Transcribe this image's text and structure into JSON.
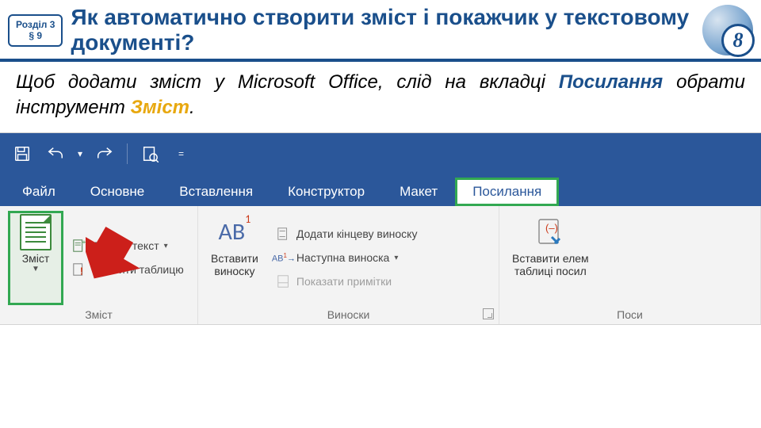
{
  "header": {
    "chapter": "Розділ 3",
    "section": "§ 9",
    "title": "Як автоматично створити зміст і покажчик у текстовому документі?",
    "grade": "8"
  },
  "intro": {
    "p1a": "Щоб додати зміст у ",
    "p1b": "Microsoft Office",
    "p1c": ", слід на вкладці ",
    "hl1": "Посилання",
    "p1d": " обрати інструмент ",
    "hl2": "Зміст",
    "p1e": "."
  },
  "titlebar": {
    "icons": [
      "save",
      "undo",
      "redo",
      "open",
      "more"
    ]
  },
  "tabs": [
    {
      "id": "file",
      "label": "Файл"
    },
    {
      "id": "home",
      "label": "Основне"
    },
    {
      "id": "insert",
      "label": "Вставлення"
    },
    {
      "id": "design",
      "label": "Конструктор"
    },
    {
      "id": "layout",
      "label": "Макет"
    },
    {
      "id": "references",
      "label": "Посилання"
    }
  ],
  "ribbon": {
    "toc": {
      "button": "Зміст",
      "add_text": "Додати текст",
      "update": "Оновити таблицю",
      "group_label": "Зміст"
    },
    "footnotes": {
      "insert_l1": "Вставити",
      "insert_l2": "виноску",
      "ab": "AB",
      "ab_sup": "1",
      "endnote": "Додати кінцеву виноску",
      "next": "Наступна виноска",
      "show": "Показати примітки",
      "group_label": "Виноски"
    },
    "citations": {
      "insert_l1": "Вставити елем",
      "insert_l2": "таблиці посил",
      "group_label": "Поси"
    }
  }
}
